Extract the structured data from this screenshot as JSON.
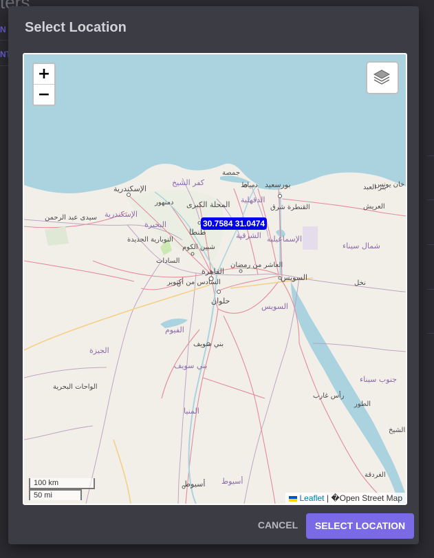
{
  "background": {
    "heading": "ters",
    "tab_1": "N",
    "tab_2": "NT"
  },
  "dialog": {
    "title": "Select Location"
  },
  "map": {
    "zoom_in": "+",
    "zoom_out": "−",
    "layers_icon": "layers-icon",
    "marker_label": "30.7584 31.0474",
    "scale_km": "100 km",
    "scale_mi": "50 mi",
    "attribution_leaflet": "Leaflet",
    "attribution_sep": "|",
    "attribution_osm": "�Open Street Map",
    "places": [
      "الإسكندرية",
      "كفر الشيخ",
      "دمنهور",
      "سيدى عبد الرحمن",
      "الإسكندرية",
      "البحيرة",
      "المحلة الكبرى",
      "جمصة",
      "دمياط",
      "الدقهلية",
      "بورسعيد",
      "القنطرة شرق",
      "بئر العبد",
      "العريش",
      "خان يونس",
      "طنطا",
      "شبين الكوم",
      "النوبارية الجديدة",
      "السادات",
      "الشرقية",
      "الإسماعيلية",
      "شمال سيناء",
      "العاشر من رمضان",
      "القاهرة",
      "السادس من أكتوبر",
      "حلوان",
      "السويس",
      "السويس",
      "نخل",
      "الفيوم",
      "بني سويف",
      "بني سويف",
      "الجيزة",
      "الواحات البحرية",
      "جنوب سيناء",
      "رأس غارب",
      "الطور",
      "شرم الشيخ",
      "المنيا",
      "الغردقة",
      "أسيوط",
      "أسيوط"
    ]
  },
  "actions": {
    "cancel": "CANCEL",
    "select": "SELECT LOCATION"
  },
  "colors": {
    "overlay": "#2b2b31",
    "dialog": "#3c3c44",
    "primary": "#7a6ae6",
    "marker": "#0000ee",
    "sea": "#aad3df",
    "land": "#f2efe9"
  }
}
